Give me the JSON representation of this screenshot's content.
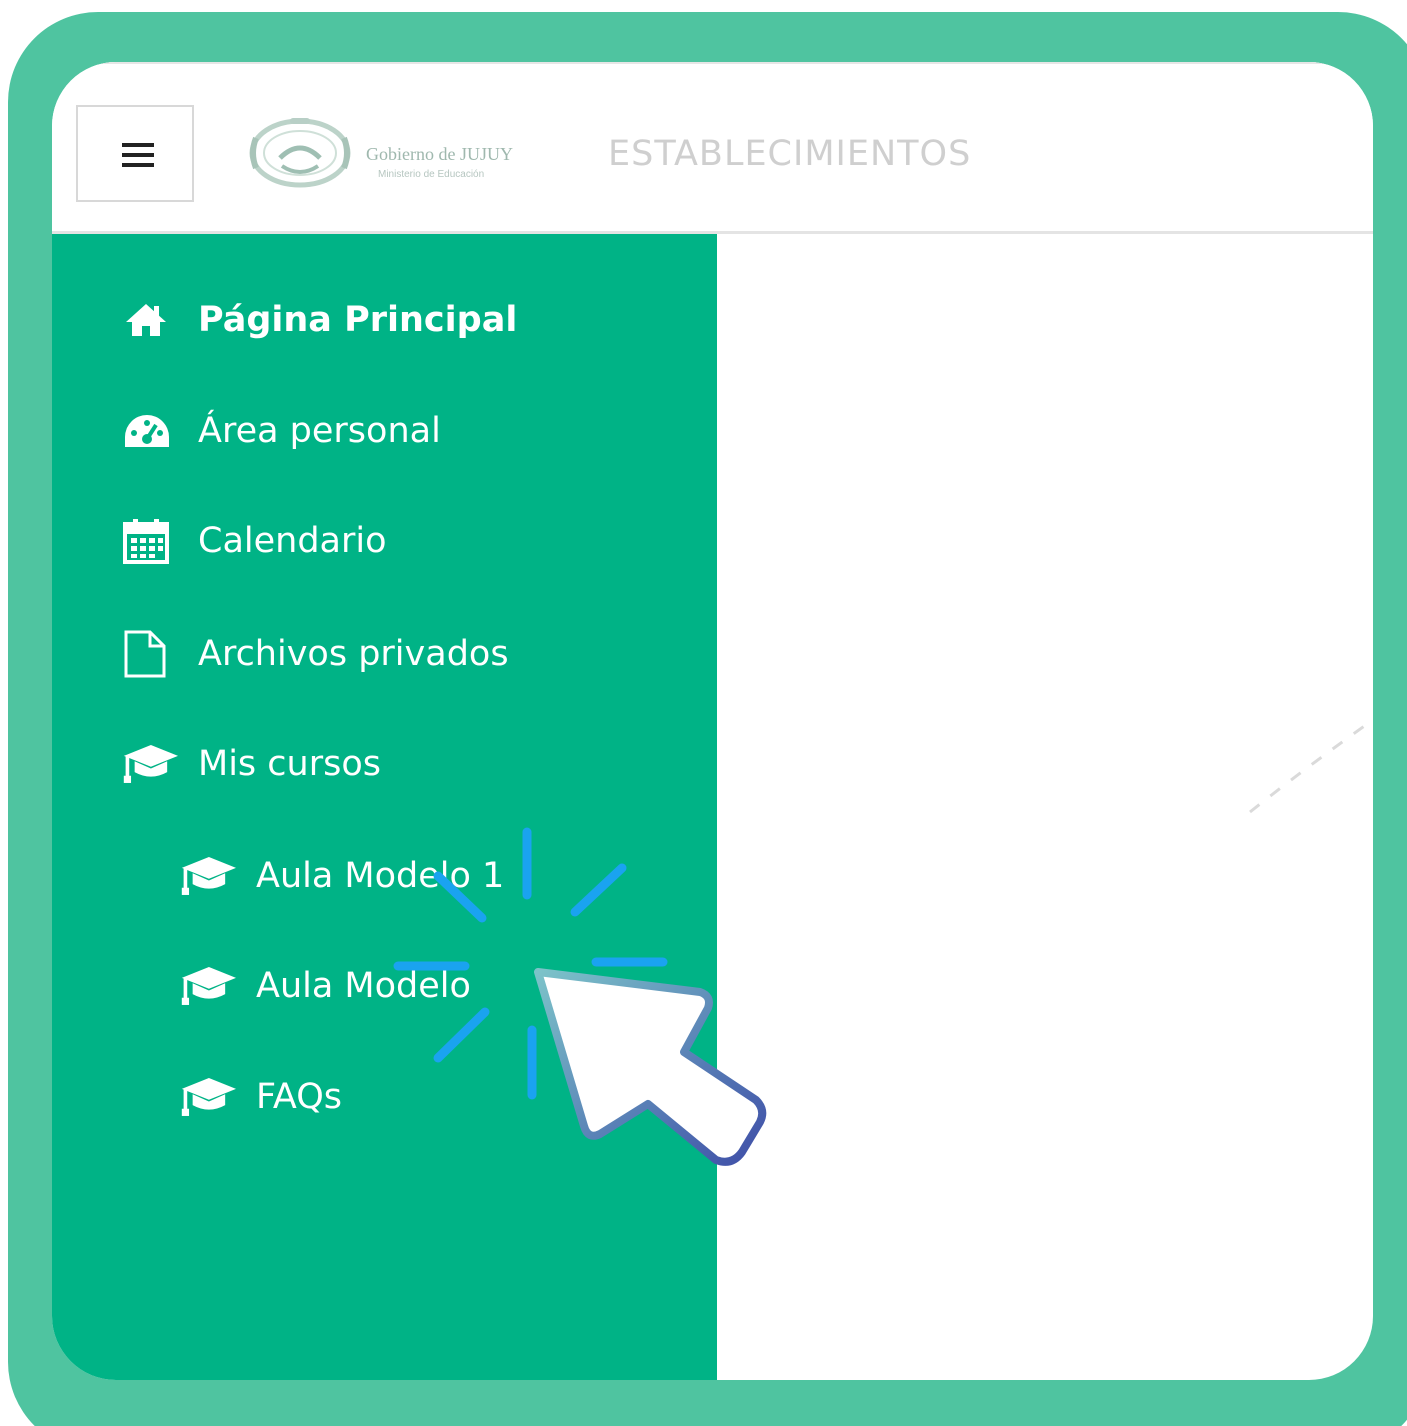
{
  "header": {
    "menu_icon": "hamburger-icon",
    "logo_text": "Gobierno de JUJUY",
    "logo_sub": "Ministerio de Educación",
    "site_title": "ESTABLECIMIENTOS"
  },
  "sidebar": {
    "items": [
      {
        "label": "Página Principal",
        "icon": "home-icon"
      },
      {
        "label": "Área personal",
        "icon": "dashboard-icon"
      },
      {
        "label": "Calendario",
        "icon": "calendar-icon"
      },
      {
        "label": "Archivos privados",
        "icon": "file-icon"
      },
      {
        "label": "Mis cursos",
        "icon": "graduation-cap-icon"
      },
      {
        "label": "Aula Modelo 1",
        "icon": "graduation-cap-icon"
      },
      {
        "label": "Aula Modelo",
        "icon": "graduation-cap-icon"
      },
      {
        "label": "FAQs",
        "icon": "graduation-cap-icon"
      }
    ]
  },
  "colors": {
    "frame": "#4fc4a0",
    "sidebar": "#00b386",
    "cursor_outline": "#3f5ab0",
    "sparkle": "#1aa3f0"
  }
}
